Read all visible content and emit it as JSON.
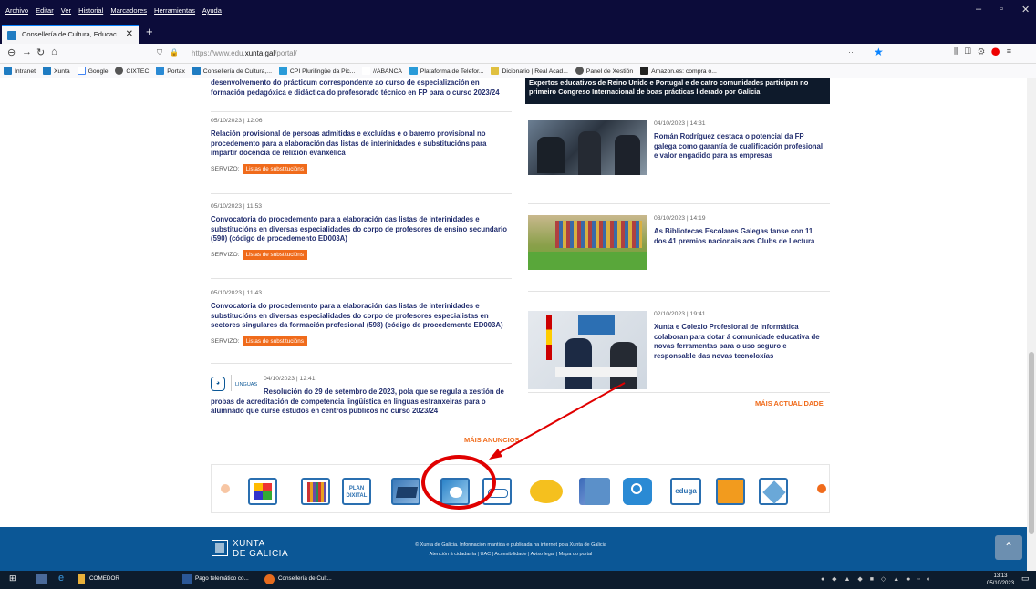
{
  "browser": {
    "menu": [
      "Archivo",
      "Editar",
      "Ver",
      "Historial",
      "Marcadores",
      "Herramientas",
      "Ayuda"
    ],
    "tab_title": "Consellería de Cultura, Educac",
    "url_prefix": "https://www.edu.",
    "url_domain": "xunta.gal",
    "url_path": "/portal/",
    "url_more": "···",
    "bookmarks": [
      "Intranet",
      "Xunta",
      "Google",
      "CIXTEC",
      "Portax",
      "Consellería de Cultura,...",
      "CPI Plurilingüe da Pic...",
      "//ABANCA",
      "Plataforma de Telefor...",
      "Dicionario | Real Acad...",
      "Panel de Xestión",
      "Amazon.es: compra o..."
    ]
  },
  "top_fragment": {
    "left": "desenvolvemento do prácticum correspondente ao curso de especialización en formación pedagóxica e didáctica do profesorado técnico en FP para o curso 2023/24",
    "right": "Expertos educativos de Reino Unido e Portugal e de catro comunidades participan no primeiro Congreso Internacional de boas prácticas liderado por Galicia"
  },
  "announcements": [
    {
      "date": "05/10/2023 | 12:06",
      "title": "Relación provisional de persoas admitidas e excluídas e o baremo provisional no procedemento para a elaboración das listas de interinidades e substitucións para impartir docencia de relixión evanxélica",
      "service_label": "SERVIZO:",
      "service": "Listas de substitucións"
    },
    {
      "date": "05/10/2023 | 11:53",
      "title": "Convocatoria do procedemento para a elaboración das listas de interinidades e substitucións en diversas especialidades do corpo de profesores de ensino secundario (590) (código de procedemento ED003A)",
      "service_label": "SERVIZO:",
      "service": "Listas de substitucións"
    },
    {
      "date": "05/10/2023 | 11:43",
      "title": "Convocatoria do procedemento para a elaboración das listas de interinidades e substitucións en diversas especialidades do corpo de profesores especialistas en sectores singulares da formación profesional (598) (código de procedemento ED003A)",
      "service_label": "SERVIZO:",
      "service": "Listas de substitucións"
    },
    {
      "date": "04/10/2023 | 12:41",
      "category": "LINGUAS",
      "title": "Resolución do 29 de setembro de 2023, pola que se regula a xestión de probas de acreditación de competencia lingüística en linguas estranxeiras para o alumnado que curse estudos en centros públicos no curso 2023/24"
    }
  ],
  "more_announcements": "MÁIS ANUNCIOS",
  "news": [
    {
      "date": "04/10/2023 | 14:31",
      "title": "Román Rodríguez destaca o potencial da FP galega como garantía de cualificación profesional e valor engadido para as empresas"
    },
    {
      "date": "03/10/2023 | 14:19",
      "title": "As Bibliotecas Escolares Galegas fanse con 11 dos 41 premios nacionais aos Clubs de Lectura"
    },
    {
      "date": "02/10/2023 | 19:41",
      "title": "Xunta e Colexio Profesional de Informática colaboran para dotar á comunidade educativa de novas ferramentas para o uso seguro e responsable das novas tecnoloxías"
    }
  ],
  "more_news": "MÁIS ACTUALIDADE",
  "carousel": {
    "items": [
      "puzzle",
      "books",
      "plan-dixital",
      "abalar",
      "edixgal",
      "espazo-educativo",
      "unidade-formacion",
      "boletins",
      "portal-web",
      "coeducacion",
      "eduga",
      "dixital",
      "cefore"
    ],
    "plan_label": "PLAN\nDIXITAL",
    "eduga_label": "eduga"
  },
  "footer": {
    "brand_line1": "XUNTA",
    "brand_line2": "DE GALICIA",
    "copyright": "© Xunta de Galicia. Información mantida e publicada na internet pola Xunta de Galicia",
    "links": "Atención á cidadanía  |  UAC  |  Accesibilidade  |  Aviso legal  |  Mapa do portal"
  },
  "taskbar": {
    "items": [
      "COMEDOR",
      "Pago telemático co...",
      "Consellería de Cult..."
    ],
    "time": "13:13",
    "date": "05/10/2023"
  },
  "colors": {
    "accent": "#f06b1b",
    "link": "#232f6f",
    "footer": "#0b5796",
    "highlight": "#e00000"
  }
}
